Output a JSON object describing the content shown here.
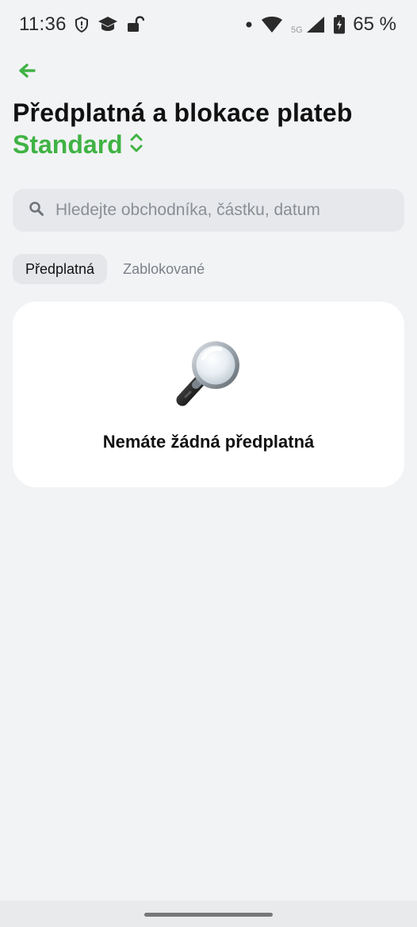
{
  "status_bar": {
    "time": "11:36",
    "network": "5G",
    "battery": "65 %",
    "icons": [
      "shield-icon",
      "graduation-cap-icon",
      "unlock-icon",
      "dot-icon",
      "wifi-icon",
      "signal-icon",
      "battery-icon"
    ]
  },
  "header": {
    "back_icon": "arrow-left-icon",
    "title": "Předplatná a blokace plateb",
    "account": "Standard",
    "account_icon": "chevron-up-down-icon"
  },
  "search": {
    "placeholder": "Hledejte obchodníka, částku, datum",
    "value": "",
    "icon": "search-icon"
  },
  "tabs": [
    {
      "label": "Předplatná",
      "active": true
    },
    {
      "label": "Zablokované",
      "active": false
    }
  ],
  "empty_state": {
    "icon": "magnifier-icon",
    "message": "Nemáte žádná předplatná"
  },
  "colors": {
    "accent": "#3fb344",
    "background": "#f2f3f5",
    "card": "#ffffff"
  }
}
